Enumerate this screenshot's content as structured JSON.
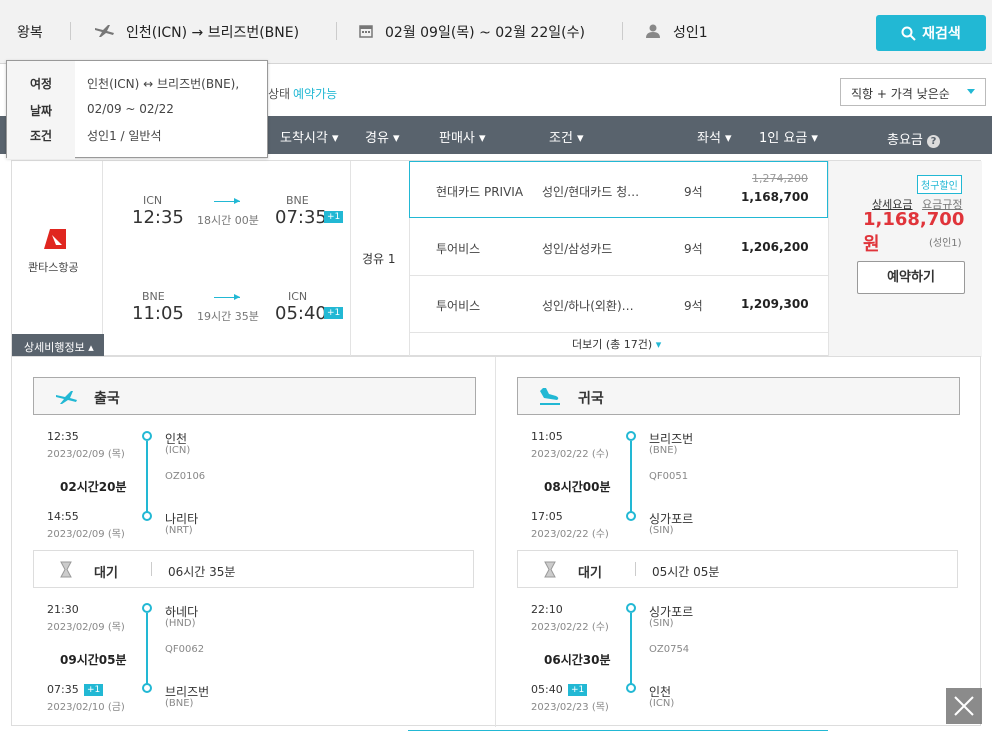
{
  "topbar": {
    "trip_type": "왕복",
    "route": "인천(ICN) → 브리즈번(BNE)",
    "dates": "02월 09일(목) ~ 02월 22일(수)",
    "pax": "성인1",
    "search_btn": "재검색"
  },
  "tooltip": {
    "trip_label": "여정",
    "trip_value": "인천(ICN) ↔ 브리즈번(BNE),",
    "date_label": "날짜",
    "date_value": "02/09 ~ 02/22",
    "cond_label": "조건",
    "cond_value": "성인1 / 일반석"
  },
  "status": {
    "partial": "상태",
    "value": "예약가능"
  },
  "sort": {
    "selected": "직항 + 가격 낮은순"
  },
  "header": {
    "arrival": "도착시각",
    "via": "경유",
    "seller": "판매사",
    "condition": "조건",
    "seat": "좌석",
    "fare": "1인 요금",
    "total": "총요금"
  },
  "airline": {
    "name": "콴타스항공",
    "detail_tab": "상세비행정보"
  },
  "outbound": {
    "dep_code": "ICN",
    "dep_time": "12:35",
    "duration": "18시간 00분",
    "arr_code": "BNE",
    "arr_time": "07:35",
    "plus": "+1"
  },
  "inbound": {
    "dep_code": "BNE",
    "dep_time": "11:05",
    "duration": "19시간 35분",
    "arr_code": "ICN",
    "arr_time": "05:40",
    "plus": "+1"
  },
  "stops": "경유 1",
  "offers": [
    {
      "seller": "현대카드 PRIVIA",
      "cond": "성인/현대카드 청…",
      "seats": "9석",
      "orig": "1,274,200",
      "price": "1,168,700"
    },
    {
      "seller": "투어비스",
      "cond": "성인/삼성카드",
      "seats": "9석",
      "price": "1,206,200"
    },
    {
      "seller": "투어비스",
      "cond": "성인/하나(외환)…",
      "seats": "9석",
      "price": "1,209,300"
    }
  ],
  "more": "더보기 (총 17건)",
  "total": {
    "badge": "청구할인",
    "detail": "상세요금",
    "rule": "요금규정",
    "amount": "1,168,700원",
    "pax": "(성인1)",
    "book": "예약하기"
  },
  "detail": {
    "out": {
      "title": "출국",
      "seg1": {
        "dep_time": "12:35",
        "dep_date": "2023/02/09 (목)",
        "dep_city": "인천",
        "dep_code": "(ICN)",
        "flight": "OZ0106",
        "dur": "02시간20분",
        "arr_time": "14:55",
        "arr_date": "2023/02/09 (목)",
        "arr_city": "나리타",
        "arr_code": "(NRT)"
      },
      "wait_label": "대기",
      "wait": "06시간 35분",
      "seg2": {
        "dep_time": "21:30",
        "dep_date": "2023/02/09 (목)",
        "dep_city": "하네다",
        "dep_code": "(HND)",
        "flight": "QF0062",
        "dur": "09시간05분",
        "arr_time": "07:35",
        "arr_plus": "+1",
        "arr_date": "2023/02/10 (금)",
        "arr_city": "브리즈번",
        "arr_code": "(BNE)"
      }
    },
    "in": {
      "title": "귀국",
      "seg1": {
        "dep_time": "11:05",
        "dep_date": "2023/02/22 (수)",
        "dep_city": "브리즈번",
        "dep_code": "(BNE)",
        "flight": "QF0051",
        "dur": "08시간00분",
        "arr_time": "17:05",
        "arr_date": "2023/02/22 (수)",
        "arr_city": "싱가포르",
        "arr_code": "(SIN)"
      },
      "wait_label": "대기",
      "wait": "05시간 05분",
      "seg2": {
        "dep_time": "22:10",
        "dep_date": "2023/02/22 (수)",
        "dep_city": "싱가포르",
        "dep_code": "(SIN)",
        "flight": "OZ0754",
        "dur": "06시간30분",
        "arr_time": "05:40",
        "arr_plus": "+1",
        "arr_date": "2023/02/23 (목)",
        "arr_city": "인천",
        "arr_code": "(ICN)"
      }
    }
  },
  "colors": {
    "accent": "#22b8d4",
    "price_red": "#e0343a",
    "header_bg": "#59636d"
  }
}
